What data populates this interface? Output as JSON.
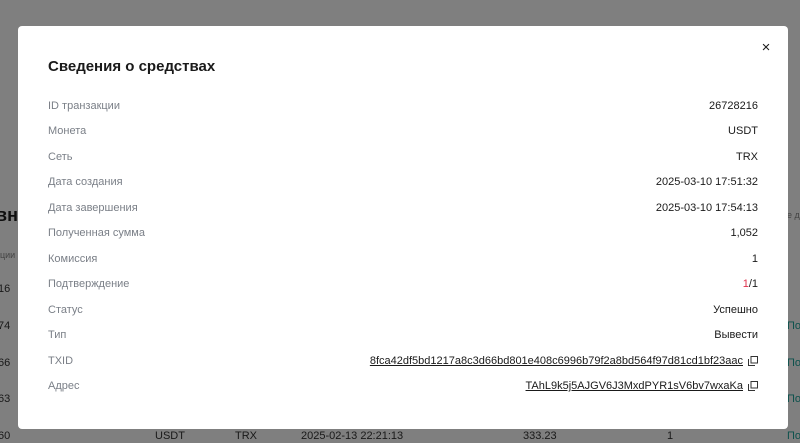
{
  "background": {
    "heading": "вни",
    "subheading": "ции",
    "right_hint": "е д",
    "left_numbers": [
      "16",
      "74",
      "66",
      "63",
      "60"
    ],
    "right_links": [
      "По",
      "По",
      "По",
      "По"
    ],
    "bottom_row": {
      "coin": "USDT",
      "network": "TRX",
      "date": "2025-02-13 22:21:13",
      "amount": "333.23",
      "fee": "1"
    }
  },
  "modal": {
    "title": "Сведения о средствах",
    "close_glyph": "×",
    "rows": [
      {
        "label": "ID транзакции",
        "value": "26728216"
      },
      {
        "label": "Монета",
        "value": "USDT"
      },
      {
        "label": "Сеть",
        "value": "TRX"
      },
      {
        "label": "Дата создания",
        "value": "2025-03-10 17:51:32"
      },
      {
        "label": "Дата завершения",
        "value": "2025-03-10 17:54:13"
      },
      {
        "label": "Полученная сумма",
        "value": "1,052"
      },
      {
        "label": "Комиссия",
        "value": "1"
      },
      {
        "label": "Подтверждение",
        "value_current": "1",
        "value_total": "/1"
      },
      {
        "label": "Статус",
        "value": "Успешно"
      },
      {
        "label": "Тип",
        "value": "Вывести"
      },
      {
        "label": "TXID",
        "value": "8fca42df5bd1217a8c3d66bd801e408c6996b79f2a8bd564f97d81cd1bf23aac",
        "icon": "copy-icon"
      },
      {
        "label": "Адрес",
        "value": "TAhL9k5j5AJGV6J3MxdPYR1sV6bv7wxaKa",
        "icon": "copy-icon"
      }
    ]
  },
  "colors": {
    "overlay": "rgba(0,0,0,0.5)",
    "label": "#7a7f87",
    "value": "#1a1a1a",
    "confirm_current": "#e0304a",
    "link_accent": "#1aa39a"
  }
}
